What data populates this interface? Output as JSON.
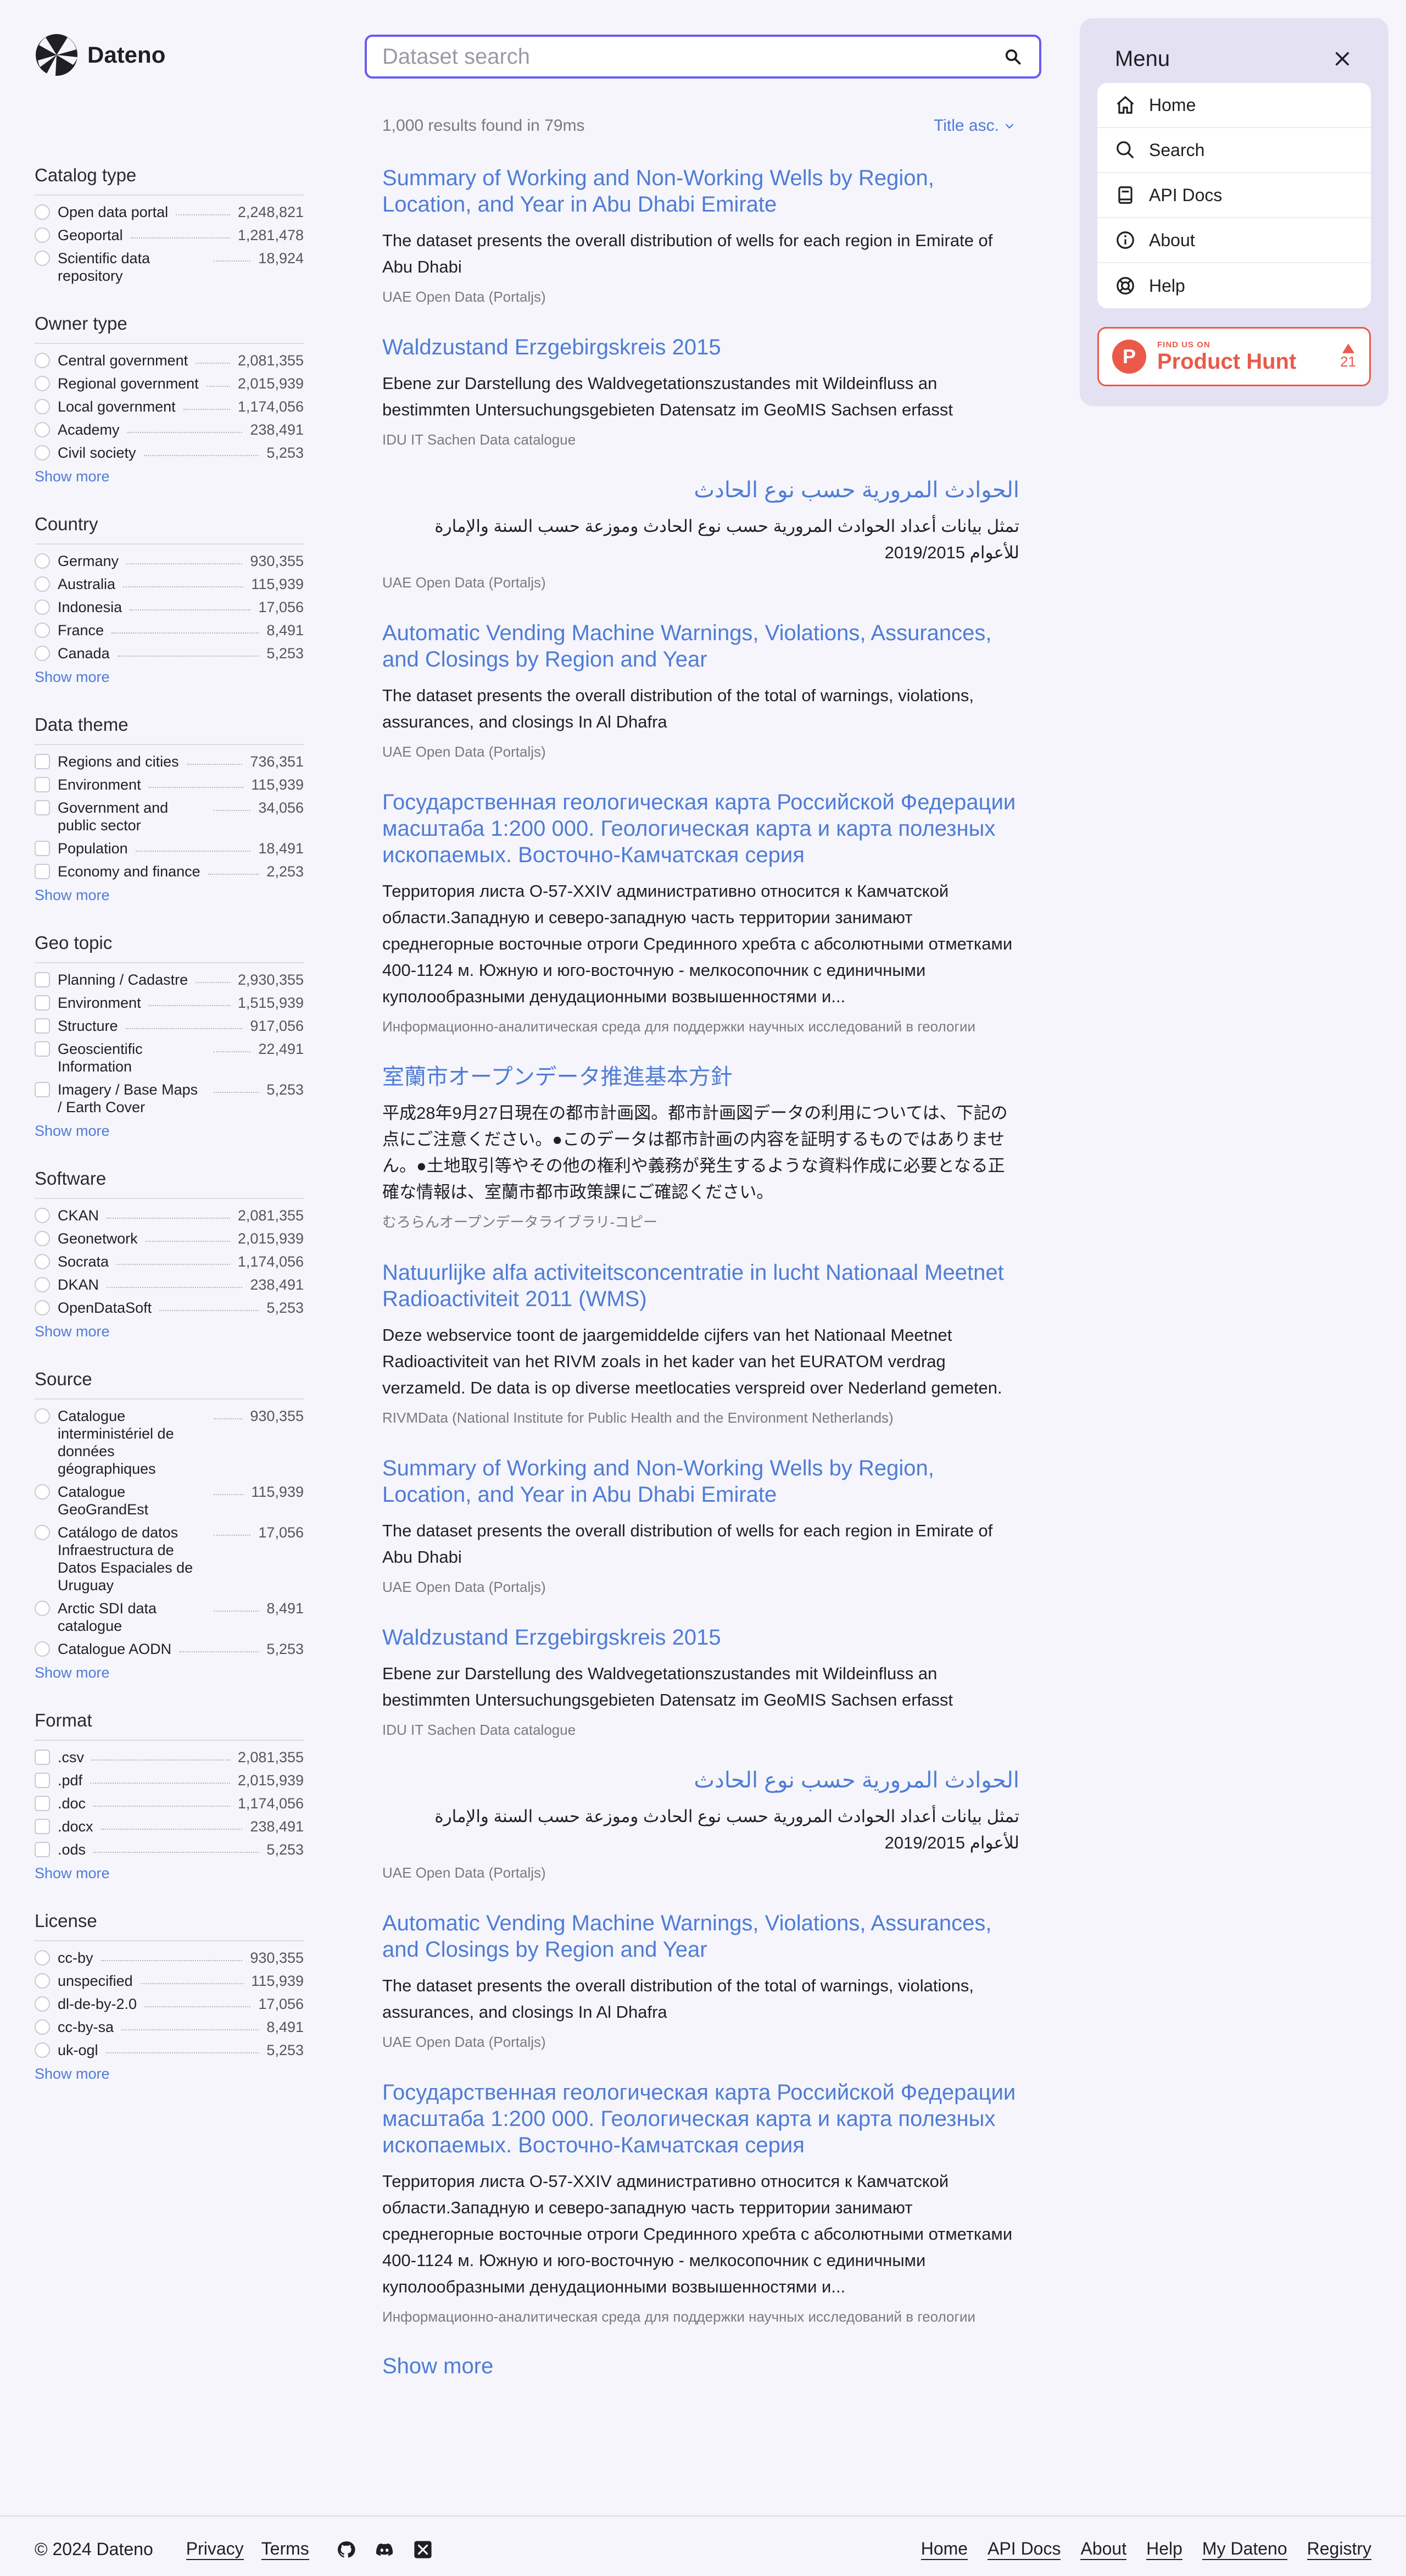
{
  "brand": {
    "name": "Dateno"
  },
  "search": {
    "placeholder": "Dataset search"
  },
  "results_meta": {
    "count_text": "1,000 results found in 79ms",
    "sort_label": "Title asc."
  },
  "facets": [
    {
      "title": "Catalog type",
      "checkbox": "round",
      "items": [
        {
          "label": "Open data portal",
          "count": "2,248,821"
        },
        {
          "label": "Geoportal",
          "count": "1,281,478"
        },
        {
          "label": "Scientific data repository",
          "count": "18,924"
        }
      ],
      "show_more": ""
    },
    {
      "title": "Owner type",
      "checkbox": "round",
      "items": [
        {
          "label": "Central government",
          "count": "2,081,355"
        },
        {
          "label": "Regional government",
          "count": "2,015,939"
        },
        {
          "label": "Local government",
          "count": "1,174,056"
        },
        {
          "label": "Academy",
          "count": "238,491"
        },
        {
          "label": "Civil society",
          "count": "5,253"
        }
      ],
      "show_more": "Show more"
    },
    {
      "title": "Country",
      "checkbox": "round",
      "items": [
        {
          "label": "Germany",
          "count": "930,355"
        },
        {
          "label": "Australia",
          "count": "115,939"
        },
        {
          "label": "Indonesia",
          "count": "17,056"
        },
        {
          "label": "France",
          "count": "8,491"
        },
        {
          "label": "Canada",
          "count": "5,253"
        }
      ],
      "show_more": "Show more"
    },
    {
      "title": "Data theme",
      "checkbox": "square",
      "items": [
        {
          "label": "Regions and cities",
          "count": "736,351"
        },
        {
          "label": "Environment",
          "count": "115,939"
        },
        {
          "label": "Government and public sector",
          "count": "34,056"
        },
        {
          "label": "Population",
          "count": "18,491"
        },
        {
          "label": "Economy and finance",
          "count": "2,253"
        }
      ],
      "show_more": "Show more"
    },
    {
      "title": "Geo topic",
      "checkbox": "square",
      "items": [
        {
          "label": "Planning / Cadastre",
          "count": "2,930,355"
        },
        {
          "label": "Environment",
          "count": "1,515,939"
        },
        {
          "label": "Structure",
          "count": "917,056"
        },
        {
          "label": "Geoscientific Information",
          "count": "22,491"
        },
        {
          "label": "Imagery / Base Maps / Earth Cover",
          "count": "5,253"
        }
      ],
      "show_more": "Show more"
    },
    {
      "title": "Software",
      "checkbox": "round",
      "items": [
        {
          "label": "CKAN",
          "count": "2,081,355"
        },
        {
          "label": "Geonetwork",
          "count": "2,015,939"
        },
        {
          "label": "Socrata",
          "count": "1,174,056"
        },
        {
          "label": "DKAN",
          "count": "238,491"
        },
        {
          "label": "OpenDataSoft",
          "count": "5,253"
        }
      ],
      "show_more": "Show more"
    },
    {
      "title": "Source",
      "checkbox": "round",
      "items": [
        {
          "label": "Catalogue interministériel de données géographiques",
          "count": "930,355"
        },
        {
          "label": "Catalogue GeoGrandEst",
          "count": "115,939"
        },
        {
          "label": "Catálogo de datos Infraestructura de Datos Espaciales de Uruguay",
          "count": "17,056"
        },
        {
          "label": "Arctic SDI data catalogue",
          "count": "8,491"
        },
        {
          "label": "Catalogue AODN",
          "count": "5,253"
        }
      ],
      "show_more": "Show more"
    },
    {
      "title": "Format",
      "checkbox": "square",
      "items": [
        {
          "label": ".csv",
          "count": "2,081,355"
        },
        {
          "label": ".pdf",
          "count": "2,015,939"
        },
        {
          "label": ".doc",
          "count": "1,174,056"
        },
        {
          "label": ".docx",
          "count": "238,491"
        },
        {
          "label": ".ods",
          "count": "5,253"
        }
      ],
      "show_more": "Show more"
    },
    {
      "title": "License",
      "checkbox": "round",
      "items": [
        {
          "label": "cc-by",
          "count": "930,355"
        },
        {
          "label": "unspecified",
          "count": "115,939"
        },
        {
          "label": "dl-de-by-2.0",
          "count": "17,056"
        },
        {
          "label": "cc-by-sa",
          "count": "8,491"
        },
        {
          "label": "uk-ogl",
          "count": "5,253"
        }
      ],
      "show_more": "Show more"
    }
  ],
  "results": [
    {
      "title": "Summary of Working and Non-Working Wells by Region, Location, and Year in Abu Dhabi Emirate",
      "description": "The dataset presents the overall distribution of wells for each region in Emirate of Abu Dhabi",
      "source": "UAE Open Data (Portaljs)",
      "dir": "ltr"
    },
    {
      "title": "Waldzustand Erzgebirgskreis 2015",
      "description": "Ebene zur Darstellung des Waldvegetationszustandes mit Wildeinfluss an bestimmten Untersuchungsgebieten Datensatz im GeoMIS Sachsen erfasst",
      "source": "IDU IT Sachen Data catalogue",
      "dir": "ltr"
    },
    {
      "title": "الحوادث المرورية حسب نوع الحادث",
      "description": "تمثل بيانات أعداد الحوادث المرورية حسب نوع الحادث وموزعة حسب السنة والإمارة للأعوام 2019/2015",
      "source": "UAE Open Data (Portaljs)",
      "dir": "rtl"
    },
    {
      "title": "Automatic Vending Machine Warnings, Violations, Assurances, and Closings by Region and Year",
      "description": "The dataset presents the overall distribution of the total of warnings, violations, assurances, and closings In Al Dhafra",
      "source": "UAE Open Data (Portaljs)",
      "dir": "ltr"
    },
    {
      "title": "Государственная геологическая карта Российской Федерации масштаба 1:200 000. Геологическая карта и карта полезных ископаемых. Восточно-Камчатская серия",
      "description": "Территория листа O-57-XXIV административно относится к Камчатской области.Западную и северо-западную часть территории занимают среднегорные восточные отроги Срединного хребта с абсолютными отметками 400-1124 м. Южную и юго-восточную - мелкосопочник с единичными куполообразными денудационными возвышенностями и...",
      "source": "Информационно-аналитическая среда для поддержки научных исследований в геологии",
      "dir": "ltr"
    },
    {
      "title": "室蘭市オープンデータ推進基本方針",
      "description": "平成28年9月27日現在の都市計画図。都市計画図データの利用については、下記の点にご注意ください。●このデータは都市計画の内容を証明するものではありません。●土地取引等やその他の権利や義務が発生するような資料作成に必要となる正確な情報は、室蘭市都市政策課にご確認ください。",
      "source": "むろらんオープンデータライブラリ-コピー",
      "dir": "ltr"
    },
    {
      "title": "Natuurlijke alfa activiteitsconcentratie in lucht Nationaal Meetnet Radioactiviteit 2011 (WMS)",
      "description": "Deze webservice toont de jaargemiddelde cijfers van het Nationaal Meetnet Radioactiviteit van het RIVM zoals in het kader van het EURATOM verdrag verzameld. De data is op diverse meetlocaties verspreid over Nederland gemeten.",
      "source": "RIVMData (National Institute for Public Health and the Environment Netherlands)",
      "dir": "ltr"
    },
    {
      "title": "Summary of Working and Non-Working Wells by Region, Location, and Year in Abu Dhabi Emirate",
      "description": "The dataset presents the overall distribution of wells for each region in Emirate of Abu Dhabi",
      "source": "UAE Open Data (Portaljs)",
      "dir": "ltr"
    },
    {
      "title": "Waldzustand Erzgebirgskreis 2015",
      "description": "Ebene zur Darstellung des Waldvegetationszustandes mit Wildeinfluss an bestimmten Untersuchungsgebieten Datensatz im GeoMIS Sachsen erfasst",
      "source": "IDU IT Sachen Data catalogue",
      "dir": "ltr"
    },
    {
      "title": "الحوادث المرورية حسب نوع الحادث",
      "description": "تمثل بيانات أعداد الحوادث المرورية حسب نوع الحادث وموزعة حسب السنة والإمارة للأعوام 2019/2015",
      "source": "UAE Open Data (Portaljs)",
      "dir": "rtl"
    },
    {
      "title": "Automatic Vending Machine Warnings, Violations, Assurances, and Closings by Region and Year",
      "description": "The dataset presents the overall distribution of the total of warnings, violations, assurances, and closings In Al Dhafra",
      "source": "UAE Open Data (Portaljs)",
      "dir": "ltr"
    },
    {
      "title": "Государственная геологическая карта Российской Федерации масштаба 1:200 000. Геологическая карта и карта полезных ископаемых. Восточно-Камчатская серия",
      "description": "Территория листа O-57-XXIV административно относится к Камчатской области.Западную и северо-западную часть территории занимают среднегорные восточные отроги Срединного хребта с абсолютными отметками 400-1124 м. Южную и юго-восточную - мелкосопочник с единичными куполообразными денудационными возвышенностями и...",
      "source": "Информационно-аналитическая среда для поддержки научных исследований в геологии",
      "dir": "ltr"
    }
  ],
  "results_show_more": "Show more",
  "menu": {
    "title": "Menu",
    "items": [
      {
        "label": "Home",
        "icon": "home-icon"
      },
      {
        "label": "Search",
        "icon": "search-icon"
      },
      {
        "label": "API Docs",
        "icon": "book-icon"
      },
      {
        "label": "About",
        "icon": "info-icon"
      },
      {
        "label": "Help",
        "icon": "lifebuoy-icon"
      }
    ],
    "product_hunt": {
      "small": "FIND US ON",
      "big": "Product Hunt",
      "votes": "21",
      "letter": "P"
    }
  },
  "footer": {
    "copyright": "© 2024 Dateno",
    "left_links": [
      "Privacy",
      "Terms"
    ],
    "socials": [
      "github-icon",
      "discord-icon",
      "x-icon"
    ],
    "right_links": [
      "Home",
      "API Docs",
      "About",
      "Help",
      "My Dateno",
      "Registry"
    ]
  },
  "colors": {
    "accent": "#4f7cd6",
    "search_border": "#6a5cf0",
    "menu_bg": "#e4e1f3",
    "product_hunt": "#ea5a4a"
  }
}
